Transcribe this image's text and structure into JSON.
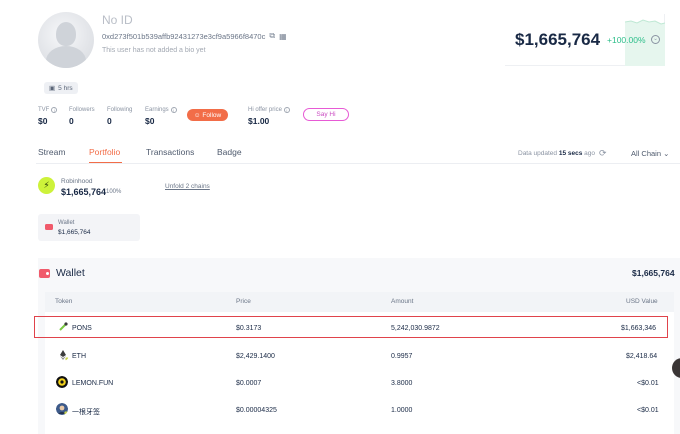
{
  "profile": {
    "name": "No ID",
    "address": "0xd273f501b539affb92431273e3cf9a5966f8470c",
    "bio": "This user has not added a bio yet",
    "age": "5 hrs"
  },
  "stats": {
    "tvf": {
      "label": "TVF",
      "value": "$0"
    },
    "followers": {
      "label": "Followers",
      "value": "0"
    },
    "following": {
      "label": "Following",
      "value": "0"
    },
    "earnings": {
      "label": "Earnings",
      "value": "$0"
    },
    "hi_offer": {
      "label": "Hi offer price",
      "value": "$1.00"
    }
  },
  "buttons": {
    "follow": "Follow",
    "say_hi": "Say Hi"
  },
  "net_worth": {
    "value": "$1,665,764",
    "change": "+100.00%"
  },
  "tabs": [
    "Stream",
    "Portfolio",
    "Transactions",
    "Badge"
  ],
  "active_tab": "Portfolio",
  "data_updated": {
    "prefix": "Data updated",
    "time": "15 secs",
    "suffix": "ago"
  },
  "chain_select": "All Chain",
  "protocol": {
    "name": "Robinhood",
    "value": "$1,665,764",
    "percent": "100%",
    "unfold": "Unfold 2 chains"
  },
  "wallet_card": {
    "label": "Wallet",
    "value": "$1,665,764"
  },
  "wallet_section": {
    "title": "Wallet",
    "total": "$1,665,764",
    "columns": [
      "Token",
      "Price",
      "Amount",
      "USD Value"
    ],
    "rows": [
      {
        "token": "PONS",
        "price": "$0.3173",
        "amount": "5,242,030.9872",
        "usd": "$1,663,346"
      },
      {
        "token": "ETH",
        "price": "$2,429.1400",
        "amount": "0.9957",
        "usd": "$2,418.64"
      },
      {
        "token": "LEMON.FUN",
        "price": "$0.0007",
        "amount": "3.8000",
        "usd": "<$0.01"
      },
      {
        "token": "一根牙签",
        "price": "$0.00004325",
        "amount": "1.0000",
        "usd": "<$0.01"
      }
    ]
  },
  "colors": {
    "accent": "#f26d48",
    "positive": "#2dbe8a",
    "highlight": "#e0434b",
    "say_hi": "#e75ad5"
  }
}
